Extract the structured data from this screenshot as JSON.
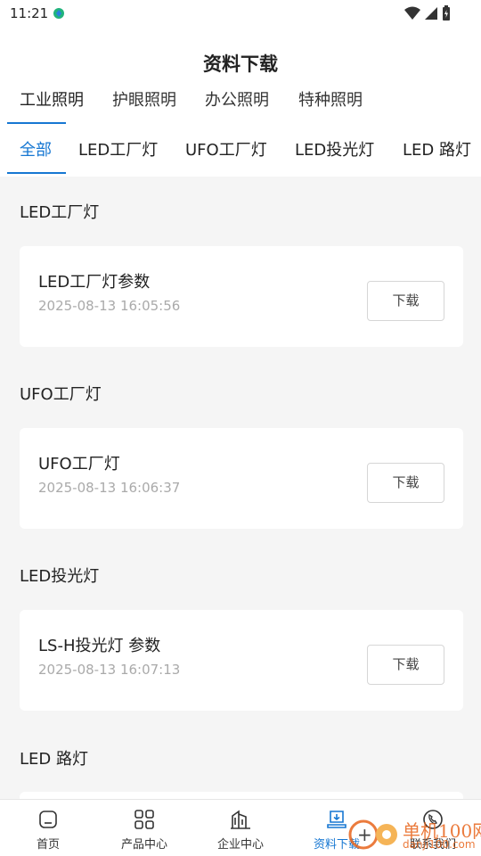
{
  "status": {
    "time": "11:21"
  },
  "page_title": "资料下载",
  "category_tabs": [
    {
      "label": "工业照明",
      "active": true
    },
    {
      "label": "护眼照明",
      "active": false
    },
    {
      "label": "办公照明",
      "active": false
    },
    {
      "label": "特种照明",
      "active": false
    }
  ],
  "sub_tabs": [
    {
      "label": "全部",
      "active": true
    },
    {
      "label": "LED工厂灯",
      "active": false
    },
    {
      "label": "UFO工厂灯",
      "active": false
    },
    {
      "label": "LED投光灯",
      "active": false
    },
    {
      "label": "LED 路灯",
      "active": false
    }
  ],
  "sections": [
    {
      "title": "LED工厂灯",
      "file": {
        "name": "LED工厂灯参数",
        "date": "2025-08-13 16:05:56",
        "button": "下载"
      }
    },
    {
      "title": "UFO工厂灯",
      "file": {
        "name": "UFO工厂灯",
        "date": "2025-08-13 16:06:37",
        "button": "下载"
      }
    },
    {
      "title": "LED投光灯",
      "file": {
        "name": "LS-H投光灯 参数",
        "date": "2025-08-13 16:07:13",
        "button": "下载"
      }
    },
    {
      "title": "LED 路灯"
    }
  ],
  "bottom_nav": [
    {
      "label": "首页",
      "icon": "home-icon",
      "active": false
    },
    {
      "label": "产品中心",
      "icon": "grid-icon",
      "active": false
    },
    {
      "label": "企业中心",
      "icon": "building-icon",
      "active": false
    },
    {
      "label": "资料下载",
      "icon": "download-icon",
      "active": true
    },
    {
      "label": "联系我们",
      "icon": "phone-icon",
      "active": false
    }
  ],
  "watermark": {
    "text": "单机100网",
    "sub": "danji100.com"
  },
  "colors": {
    "accent": "#1677d2",
    "background": "#f5f5f5",
    "watermark": "#e8651c"
  }
}
